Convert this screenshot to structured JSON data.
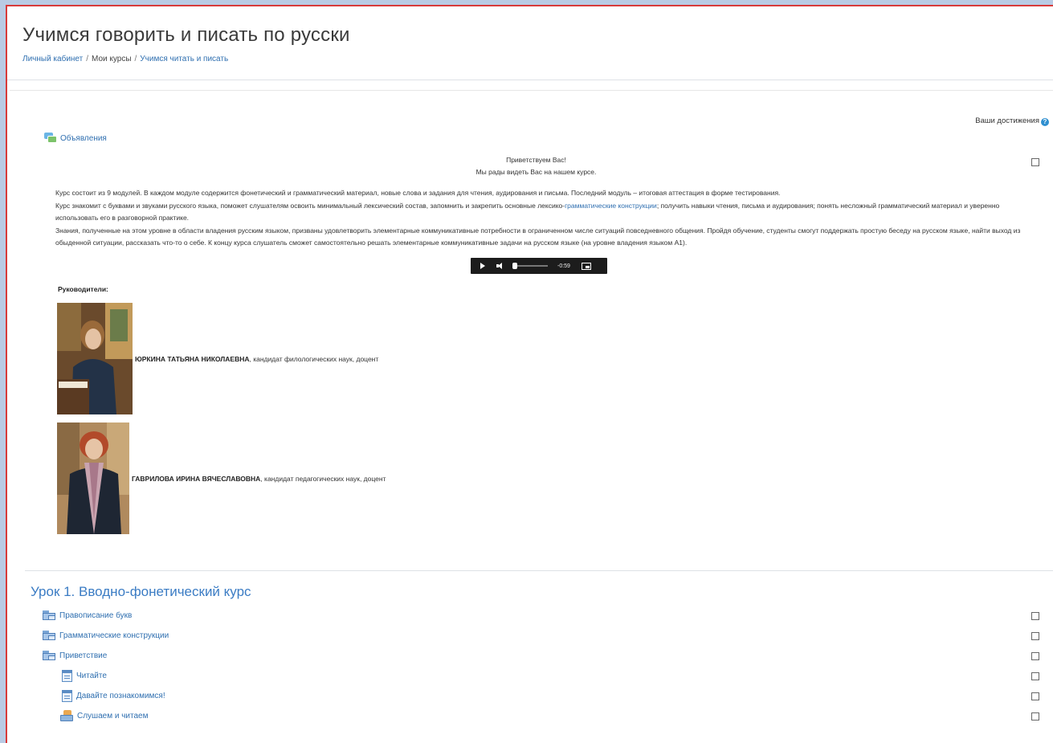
{
  "page": {
    "title": "Учимся говорить и писать по русски",
    "breadcrumb": {
      "home": "Личный кабинет",
      "courses": "Мои курсы",
      "current": "Учимся читать и писать",
      "separator": "/"
    }
  },
  "achievements": {
    "label": "Ваши достижения",
    "help_icon": "?"
  },
  "announcements": {
    "label": "Объявления",
    "icon": "forum-icon"
  },
  "intro": {
    "greeting": "Приветствуем Вас!",
    "welcome": "Мы рады видеть Вас на нашем курсе.",
    "para1": "Курс состоит из 9 модулей. В каждом модуле содержится фонетический и грамматический материал, новые слова и задания для чтения, аудирования и письма. Последний модуль – итоговая аттестация в форме тестирования.",
    "para2_a": "Курс знакомит с буквами и звуками русского языка, поможет слушателям освоить минимальный лексический состав, запомнить и закрепить основные лексико-",
    "para2_link": "грамматические конструкции",
    "para2_b": "; получить навыки чтения, письма и аудирования; понять несложный грамматический материал и уверенно использовать его в разговорной практике.",
    "para3": "Знания, полученные на этом уровне в области владения русским языком, призваны удовлетворить элементарные коммуникативные потребности в ограниченном числе ситуаций повседневного общения. Пройдя обучение, студенты смогут поддержать простую беседу на русском языке, найти выход из обыденной ситуации, рассказать что-то о себе. К концу курса слушатель сможет самостоятельно решать элементарные коммуникативные задачи на русском языке (на уровне владения языком А1).",
    "audio_time": "-0:59",
    "leaders_label": "Руководители:"
  },
  "leaders": [
    {
      "name": "ЮРКИНА ТАТЬЯНА НИКОЛАЕВНА",
      "title": ", кандидат филологических наук, доцент"
    },
    {
      "name": "ГАВРИЛОВА ИРИНА ВЯЧЕСЛАВОВНА",
      "title": ", кандидат педагогических наук, доцент"
    }
  ],
  "section1": {
    "title": "Урок 1. Вводно-фонетический курс",
    "items": [
      {
        "label": "Правописание букв",
        "icon": "folder-icon"
      },
      {
        "label": "Грамматические конструкции",
        "icon": "folder-icon"
      },
      {
        "label": "Приветствие",
        "icon": "folder-icon"
      },
      {
        "label": "Читайте",
        "icon": "page-icon"
      },
      {
        "label": "Давайте познакомимся!",
        "icon": "page-icon"
      },
      {
        "label": "Слушаем и читаем",
        "icon": "lesson-icon"
      }
    ]
  },
  "colors": {
    "accent": "#2f6fb0",
    "frame_border": "#d83a3a",
    "outer_bg": "#b9cbe4"
  }
}
